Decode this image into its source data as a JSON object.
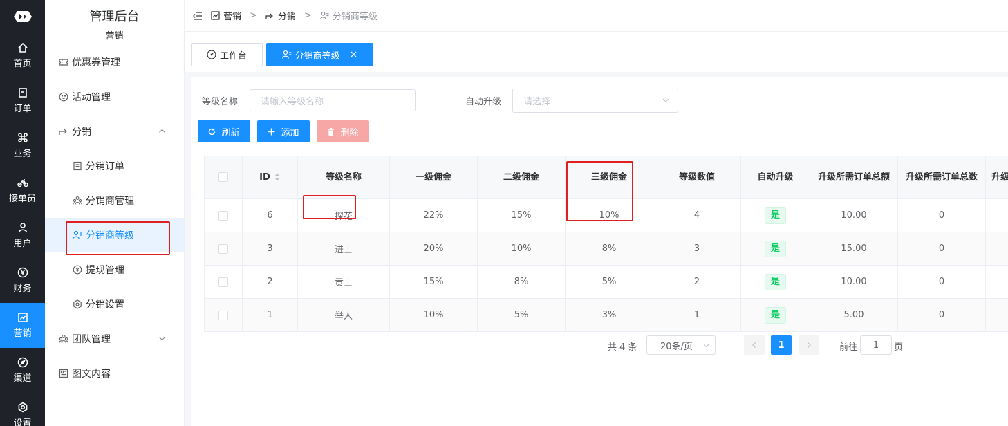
{
  "rail": {
    "items": [
      {
        "label": "首页",
        "icon": "home-icon"
      },
      {
        "label": "订单",
        "icon": "order-icon"
      },
      {
        "label": "业务",
        "icon": "command-icon"
      },
      {
        "label": "接单员",
        "icon": "bike-icon"
      },
      {
        "label": "用户",
        "icon": "user-icon"
      },
      {
        "label": "财务",
        "icon": "yen-icon"
      },
      {
        "label": "营销",
        "icon": "chart-icon"
      },
      {
        "label": "渠道",
        "icon": "compass-icon"
      },
      {
        "label": "设置",
        "icon": "settings-icon"
      }
    ]
  },
  "sidebar": {
    "title": "管理后台",
    "group": "营销",
    "items": [
      {
        "label": "优惠券管理"
      },
      {
        "label": "活动管理"
      },
      {
        "label": "分销"
      },
      {
        "label": "分销订单"
      },
      {
        "label": "分销商管理"
      },
      {
        "label": "分销商等级"
      },
      {
        "label": "提现管理"
      },
      {
        "label": "分销设置"
      },
      {
        "label": "团队管理"
      },
      {
        "label": "图文内容"
      }
    ]
  },
  "breadcrumb": {
    "items": [
      "营销",
      "分销",
      "分销商等级"
    ],
    "separator": ">"
  },
  "tabs": {
    "items": [
      "工作台",
      "分销商等级"
    ],
    "close": "×"
  },
  "filters": {
    "level_name_label": "等级名称",
    "level_name_placeholder": "请输入等级名称",
    "auto_upgrade_label": "自动升级",
    "auto_upgrade_placeholder": "请选择"
  },
  "toolbar": {
    "refresh": "刷新",
    "add": "添加",
    "delete": "删除"
  },
  "table": {
    "headers": [
      "ID",
      "等级名称",
      "一级佣金",
      "二级佣金",
      "三级佣金",
      "等级数值",
      "自动升级",
      "升级所需订单总额",
      "升级所需订单总数",
      "升级"
    ],
    "rows": [
      {
        "id": "6",
        "name": "探花",
        "c1": "22%",
        "c2": "15%",
        "c3": "10%",
        "value": "4",
        "auto": "是",
        "amount": "10.00",
        "count": "0"
      },
      {
        "id": "3",
        "name": "进士",
        "c1": "20%",
        "c2": "10%",
        "c3": "8%",
        "value": "3",
        "auto": "是",
        "amount": "15.00",
        "count": "0"
      },
      {
        "id": "2",
        "name": "贡士",
        "c1": "15%",
        "c2": "8%",
        "c3": "5%",
        "value": "2",
        "auto": "是",
        "amount": "10.00",
        "count": "0"
      },
      {
        "id": "1",
        "name": "举人",
        "c1": "10%",
        "c2": "5%",
        "c3": "3%",
        "value": "1",
        "auto": "是",
        "amount": "5.00",
        "count": "0"
      }
    ]
  },
  "pagination": {
    "total": "共 4 条",
    "page_size": "20条/页",
    "current_page": "1",
    "goto_label": "前往",
    "goto_value": "1",
    "goto_suffix": "页"
  },
  "colors": {
    "primary": "#1890ff",
    "rail_bg": "#1f2229",
    "highlight": "#e02020",
    "tag_green": "#13ce66"
  }
}
